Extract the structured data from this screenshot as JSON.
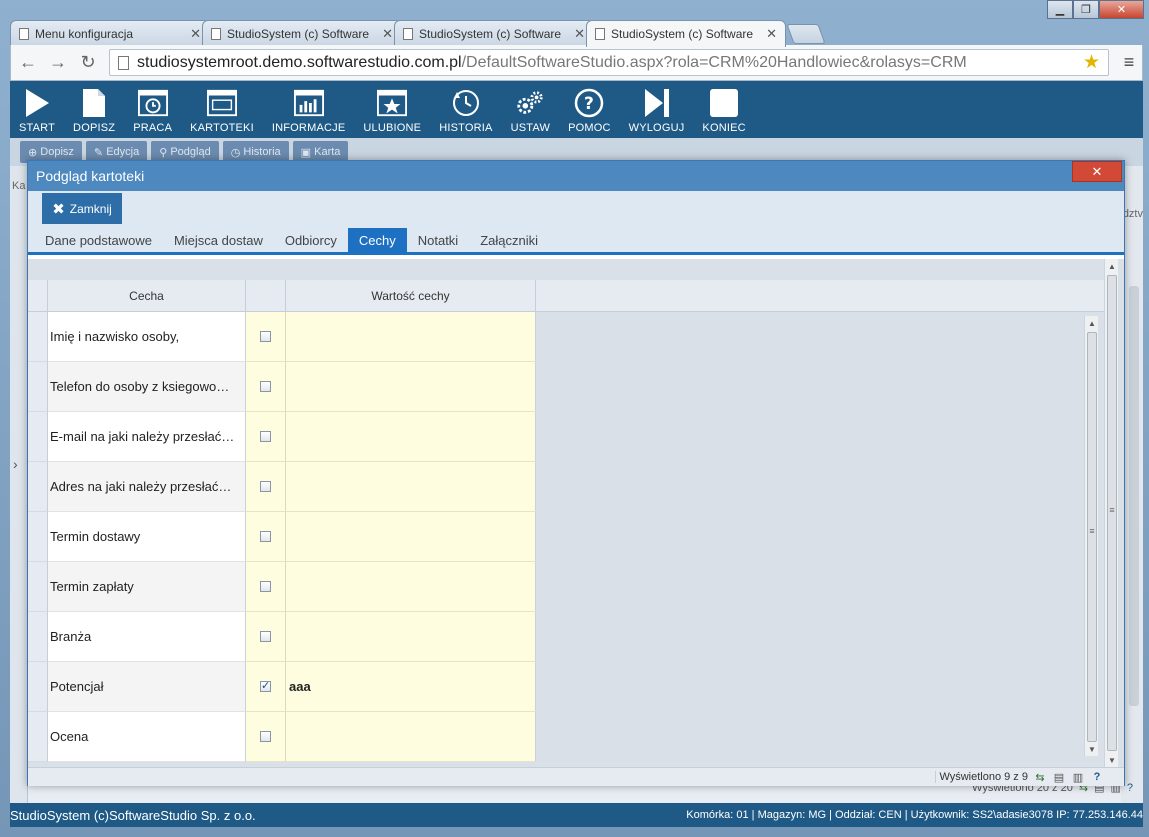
{
  "browser": {
    "tabs": [
      {
        "title": "Menu konfiguracja",
        "active": false
      },
      {
        "title": "StudioSystem (c) Software",
        "active": false
      },
      {
        "title": "StudioSystem (c) Software",
        "active": false
      },
      {
        "title": "StudioSystem (c) Software",
        "active": true
      }
    ],
    "url_host": "studiosystemroot.demo.softwarestudio.com.pl",
    "url_path": "/DefaultSoftwareStudio.aspx?rola=CRM%20Handlowiec&rolasys=CRM"
  },
  "main_menu": [
    {
      "label": "START",
      "icon": "play-icon"
    },
    {
      "label": "DOPISZ",
      "icon": "new-document-icon"
    },
    {
      "label": "PRACA",
      "icon": "clock-window-icon"
    },
    {
      "label": "KARTOTEKI",
      "icon": "window-icon"
    },
    {
      "label": "INFORMACJE",
      "icon": "bar-chart-icon"
    },
    {
      "label": "ULUBIONE",
      "icon": "star-window-icon"
    },
    {
      "label": "HISTORIA",
      "icon": "history-icon"
    },
    {
      "label": "USTAW",
      "icon": "gears-icon"
    },
    {
      "label": "POMOC",
      "icon": "help-icon"
    },
    {
      "label": "WYLOGUJ",
      "icon": "logout-icon"
    },
    {
      "label": "KONIEC",
      "icon": "stop-icon"
    }
  ],
  "sub_toolbar": [
    "Dopisz",
    "Edycja",
    "Podgląd",
    "Historia",
    "Karta"
  ],
  "background": {
    "left_label": "Ka",
    "right_label": "dztv",
    "footer_text": "Wyświetlono 20 z 20"
  },
  "modal": {
    "title": "Podgląd kartoteki",
    "close_label": "Zamknij",
    "tabs": [
      {
        "label": "Dane podstawowe",
        "active": false
      },
      {
        "label": "Miejsca dostaw",
        "active": false
      },
      {
        "label": "Odbiorcy",
        "active": false
      },
      {
        "label": "Cechy",
        "active": true
      },
      {
        "label": "Notatki",
        "active": false
      },
      {
        "label": "Załączniki",
        "active": false
      }
    ],
    "grid": {
      "columns": [
        "Cecha",
        "",
        "Wartość cechy"
      ],
      "rows": [
        {
          "cecha": "Imię i nazwisko osoby,",
          "checked": false,
          "value": ""
        },
        {
          "cecha": "Telefon do osoby z ksiegowo…",
          "checked": false,
          "value": ""
        },
        {
          "cecha": "E-mail na jaki należy przesłać…",
          "checked": false,
          "value": ""
        },
        {
          "cecha": "Adres na jaki należy przesłać…",
          "checked": false,
          "value": ""
        },
        {
          "cecha": "Termin dostawy",
          "checked": false,
          "value": ""
        },
        {
          "cecha": "Termin zapłaty",
          "checked": false,
          "value": ""
        },
        {
          "cecha": "Branża",
          "checked": false,
          "value": ""
        },
        {
          "cecha": "Potencjał",
          "checked": true,
          "value": "aaa"
        },
        {
          "cecha": "Ocena",
          "checked": false,
          "value": ""
        }
      ],
      "footer_text": "Wyświetlono 9 z 9"
    }
  },
  "status_bar": {
    "left": "StudioSystem (c)SoftwareStudio Sp. z o.o.",
    "right": "Komórka: 01 | Magazyn: MG | Oddział: CEN | Użytkownik: SS2\\adasie3078 IP: 77.253.146.44"
  }
}
